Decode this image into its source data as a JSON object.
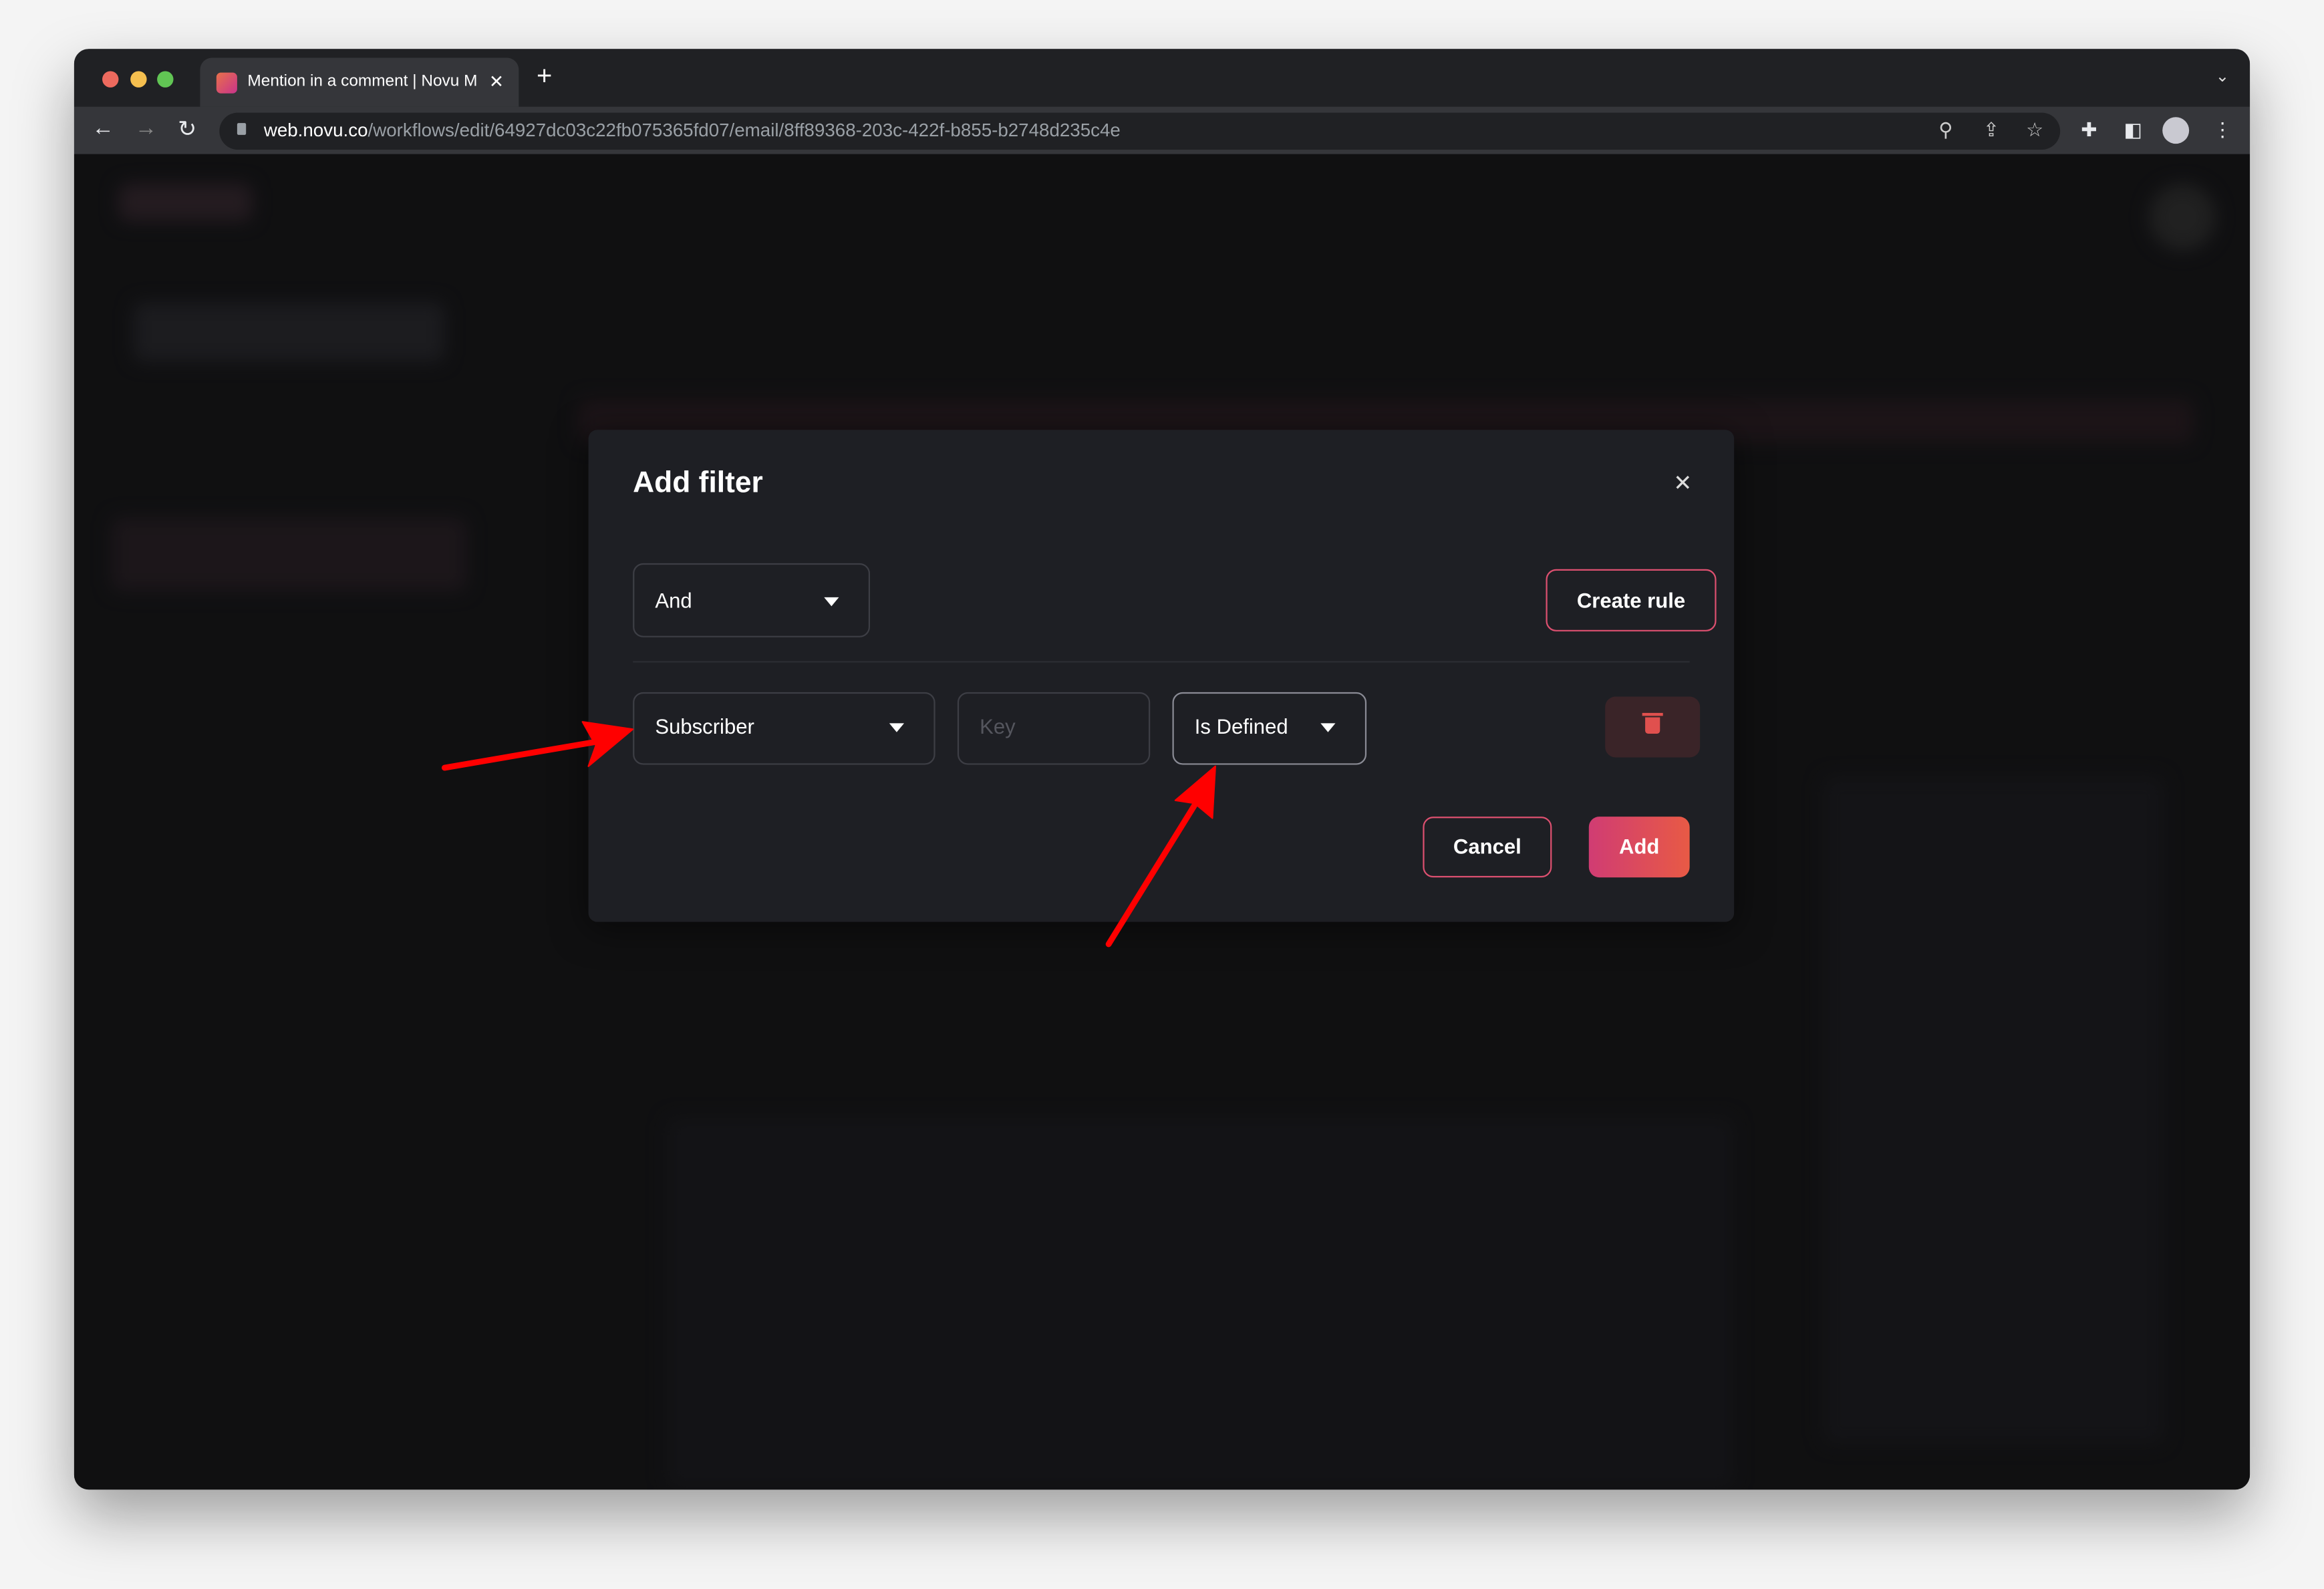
{
  "browser": {
    "tab_title": "Mention in a comment | Novu M",
    "url_host": "web.novu.co",
    "url_path": "/workflows/edit/64927dc03c22fb075365fd07/email/8ff89368-203c-422f-b855-b2748d235c4e"
  },
  "modal": {
    "title": "Add filter",
    "logic_select": "And",
    "create_rule_label": "Create rule",
    "rule": {
      "on_select": "Subscriber",
      "key_placeholder": "Key",
      "operator_select": "Is Defined"
    },
    "cancel_label": "Cancel",
    "add_label": "Add"
  },
  "colors": {
    "accent_start": "#d03c73",
    "accent_end": "#e85a45",
    "annotation_arrow": "#ff0000"
  }
}
